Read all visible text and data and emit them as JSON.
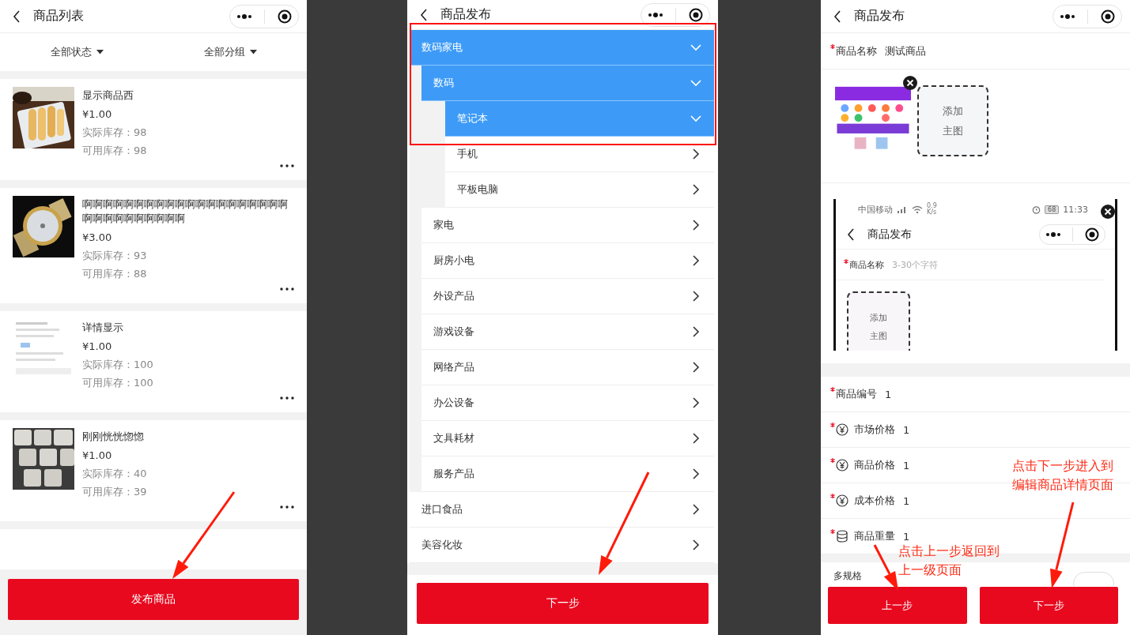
{
  "product_list": {
    "title": "商品列表",
    "filters": [
      {
        "label": "全部状态"
      },
      {
        "label": "全部分组"
      }
    ],
    "items": [
      {
        "name": "显示商品西",
        "price": "¥1.00",
        "actual_stock": "实际库存：98",
        "available_stock": "可用库存：98"
      },
      {
        "name": "啊啊啊啊啊啊啊啊啊啊啊啊啊啊啊啊啊啊啊啊啊啊啊啊啊啊啊啊啊啊",
        "price": "¥3.00",
        "actual_stock": "实际库存：93",
        "available_stock": "可用库存：88"
      },
      {
        "name": "详情显示",
        "price": "¥1.00",
        "actual_stock": "实际库存：100",
        "available_stock": "可用库存：100"
      },
      {
        "name": "刚刚恍恍惚惚",
        "price": "¥1.00",
        "actual_stock": "实际库存：40",
        "available_stock": "可用库存：39"
      }
    ],
    "button": "发布商品"
  },
  "category_picker": {
    "title": "商品发布",
    "tree": [
      {
        "label": "数码家电",
        "expanded": true,
        "selected": true,
        "children": [
          {
            "label": "数码",
            "expanded": true,
            "selected": true,
            "children": [
              {
                "label": "笔记本",
                "expanded": true,
                "selected": true
              },
              {
                "label": "手机",
                "expanded": false,
                "selected": false
              },
              {
                "label": "平板电脑",
                "expanded": false,
                "selected": false
              }
            ]
          },
          {
            "label": "家电",
            "expanded": false,
            "selected": false
          },
          {
            "label": "厨房小电",
            "expanded": false,
            "selected": false
          },
          {
            "label": "外设产品",
            "expanded": false,
            "selected": false
          },
          {
            "label": "游戏设备",
            "expanded": false,
            "selected": false
          },
          {
            "label": "网络产品",
            "expanded": false,
            "selected": false
          },
          {
            "label": "办公设备",
            "expanded": false,
            "selected": false
          },
          {
            "label": "文具耗材",
            "expanded": false,
            "selected": false
          },
          {
            "label": "服务产品",
            "expanded": false,
            "selected": false
          }
        ]
      },
      {
        "label": "进口食品",
        "expanded": false,
        "selected": false
      },
      {
        "label": "美容化妆",
        "expanded": false,
        "selected": false
      }
    ],
    "button": "下一步"
  },
  "product_form": {
    "title": "商品发布",
    "name_field": {
      "label": "商品名称",
      "value": "测试商品",
      "required": true
    },
    "add_image_label": "添加主图",
    "preview": {
      "carrier": "中国移动",
      "speed": "0.9\nK/s",
      "battery": "68",
      "time": "11:33",
      "title": "商品发布",
      "name_field": {
        "label": "商品名称",
        "placeholder": "3-30个字符",
        "required": true
      },
      "add_image_label": "添加主图"
    },
    "fields": [
      {
        "label": "商品编号",
        "value": "1",
        "required": true,
        "kind": "plain"
      },
      {
        "label": "市场价格",
        "value": "1",
        "required": true,
        "kind": "price"
      },
      {
        "label": "商品价格",
        "value": "1",
        "required": true,
        "kind": "price"
      },
      {
        "label": "成本价格",
        "value": "1",
        "required": true,
        "kind": "price"
      },
      {
        "label": "商品重量",
        "value": "1",
        "required": true,
        "kind": "weight"
      }
    ],
    "spec_label": "多规格",
    "spec_enabled": false,
    "buttons": [
      {
        "label": "上一步"
      },
      {
        "label": "下一步"
      }
    ]
  },
  "annotations": [
    {
      "text": "点击下一步进入到编辑商品详情页面"
    },
    {
      "text": "点击上一步返回到上一级页面"
    }
  ]
}
